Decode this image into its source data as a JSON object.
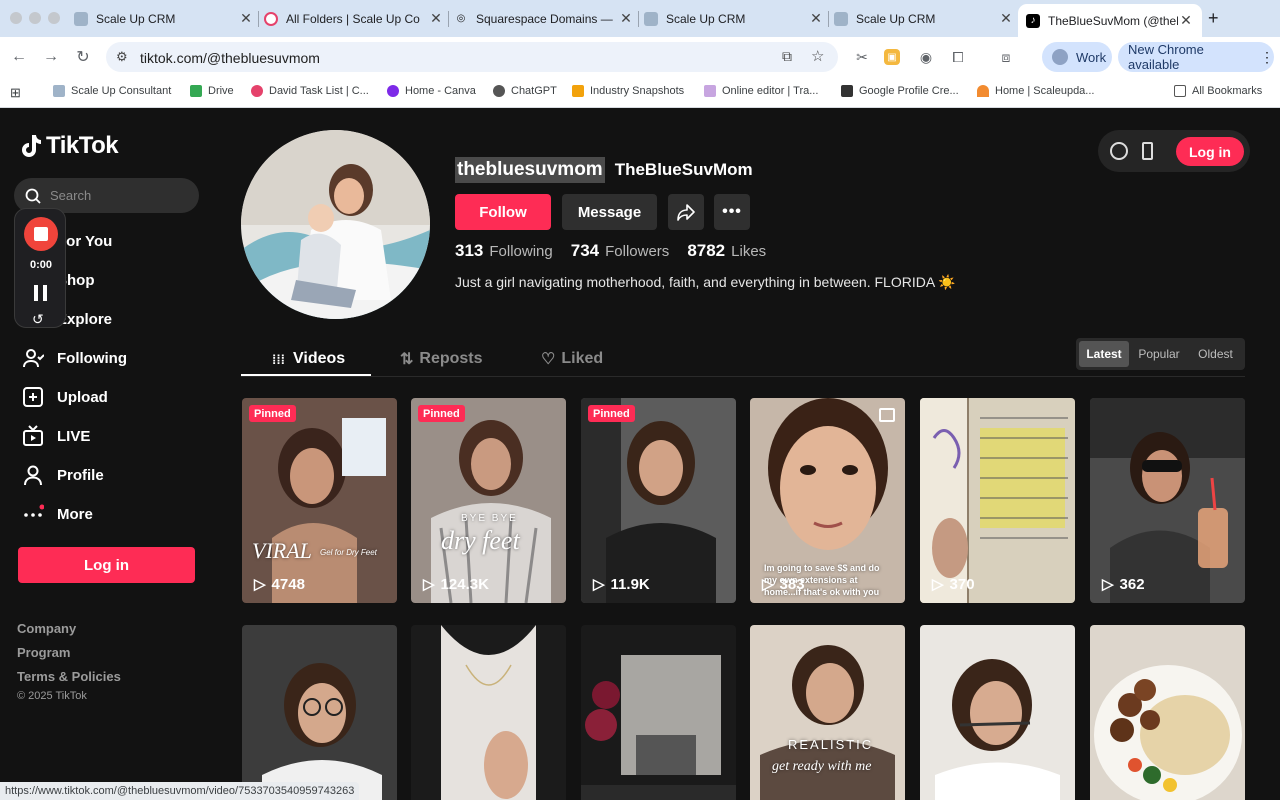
{
  "browser": {
    "tabs": [
      {
        "title": "Scale Up CRM"
      },
      {
        "title": "All Folders | Scale Up Co"
      },
      {
        "title": "Squarespace Domains —"
      },
      {
        "title": "Scale Up CRM"
      },
      {
        "title": "Scale Up CRM"
      },
      {
        "title": "TheBlueSuvMom (@theb"
      }
    ],
    "url": "tiktok.com/@thebluesuvmom",
    "profile_label": "Work",
    "update_label": "New Chrome available",
    "bookmarks": [
      "Scale Up Consultant",
      "Drive",
      "David Task List | C...",
      "Home - Canva",
      "ChatGPT",
      "Industry Snapshots",
      "Online editor | Tra...",
      "Google Profile Cre...",
      "Home | Scaleupda..."
    ],
    "all_bookmarks": "All Bookmarks",
    "status_url": "https://www.tiktok.com/@thebluesuvmom/video/7533703540959743263"
  },
  "recorder": {
    "time": "0:00"
  },
  "sidebar": {
    "logo": "TikTok",
    "search_placeholder": "Search",
    "nav": [
      {
        "label": "For You",
        "icon": "home-icon"
      },
      {
        "label": "Shop",
        "icon": "shop-icon"
      },
      {
        "label": "Explore",
        "icon": "explore-icon"
      },
      {
        "label": "Following",
        "icon": "following-icon"
      },
      {
        "label": "Upload",
        "icon": "upload-icon"
      },
      {
        "label": "LIVE",
        "icon": "live-icon"
      },
      {
        "label": "Profile",
        "icon": "profile-icon"
      },
      {
        "label": "More",
        "icon": "more-icon"
      }
    ],
    "login": "Log in",
    "footer": [
      "Company",
      "Program",
      "Terms & Policies"
    ],
    "copyright": "© 2025 TikTok"
  },
  "profile": {
    "username": "thebluesuvmom",
    "nickname": "TheBlueSuvMom",
    "follow": "Follow",
    "message": "Message",
    "following_count": "313",
    "following_label": "Following",
    "followers_count": "734",
    "followers_label": "Followers",
    "likes_count": "8782",
    "likes_label": "Likes",
    "bio": "Just a girl navigating motherhood, faith, and everything in between. FLORIDA ☀️"
  },
  "header_login": "Log in",
  "tabs": {
    "videos": "Videos",
    "reposts": "Reposts",
    "liked": "Liked"
  },
  "sort": {
    "latest": "Latest",
    "popular": "Popular",
    "oldest": "Oldest"
  },
  "videos": [
    {
      "views": "4748",
      "pinned": "Pinned",
      "overlay": "VIRAL",
      "overlay_sub": "Gel for Dry Feet"
    },
    {
      "views": "124.3K",
      "pinned": "Pinned",
      "overlay": "BYE BYE",
      "overlay_sub": "dry feet"
    },
    {
      "views": "11.9K",
      "pinned": "Pinned"
    },
    {
      "views": "383",
      "overlay": "Im going to save $$ and do my own extensions at home...if that's ok with you"
    },
    {
      "views": "370"
    },
    {
      "views": "362"
    },
    {},
    {},
    {},
    {
      "overlay": "REALISTIC",
      "overlay_sub": "get ready with me"
    },
    {},
    {}
  ]
}
